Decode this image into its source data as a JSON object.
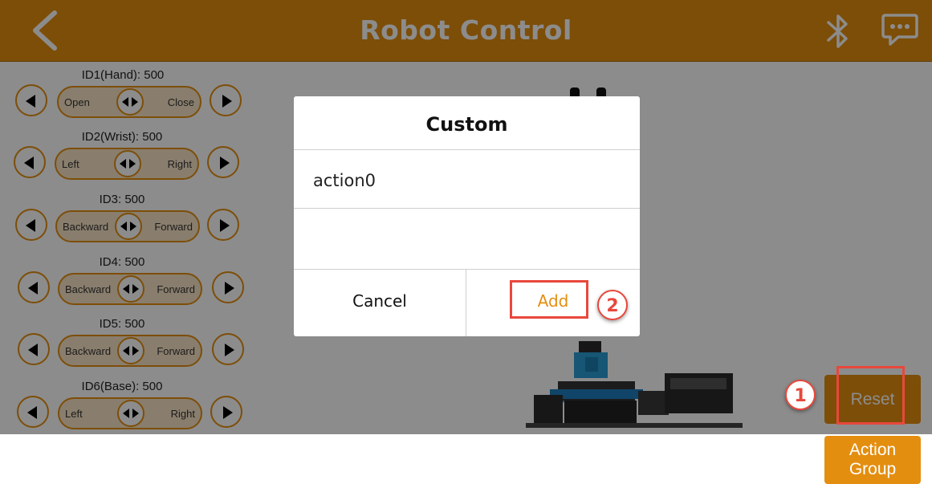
{
  "header": {
    "title": "Robot Control"
  },
  "servos": [
    {
      "label": "ID1(Hand):  500",
      "left": "Open",
      "right": "Close"
    },
    {
      "label": "ID2(Wrist):  500",
      "left": "Left",
      "right": "Right"
    },
    {
      "label": "ID3:  500",
      "left": "Backward",
      "right": "Forward"
    },
    {
      "label": "ID4:  500",
      "left": "Backward",
      "right": "Forward"
    },
    {
      "label": "ID5:  500",
      "left": "Backward",
      "right": "Forward"
    },
    {
      "label": "ID6(Base):  500",
      "left": "Left",
      "right": "Right"
    }
  ],
  "buttons": {
    "reset": "Reset",
    "action_group_line1": "Action",
    "action_group_line2": "Group"
  },
  "dialog": {
    "title": "Custom",
    "input_value": "action0",
    "cancel": "Cancel",
    "add": "Add"
  },
  "annotations": {
    "step1": "1",
    "step2": "2"
  },
  "colors": {
    "accent": "#e48e10",
    "highlight": "#e8483c"
  },
  "icons": [
    "back-arrow-icon",
    "bluetooth-icon",
    "chat-icon",
    "left-arrow-icon",
    "right-arrow-icon"
  ]
}
